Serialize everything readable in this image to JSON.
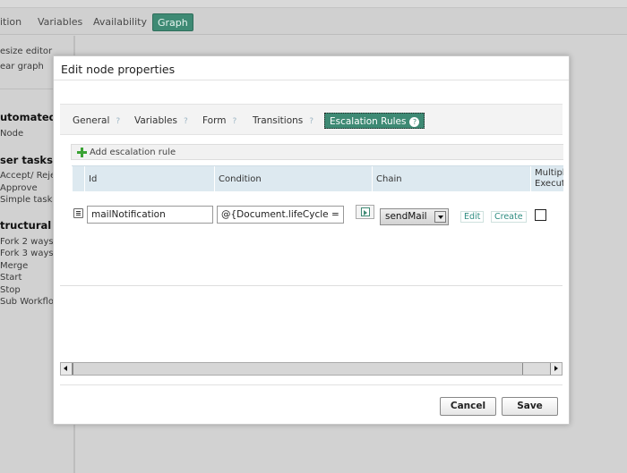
{
  "background": {
    "top_tabs": [
      {
        "label": "ition"
      },
      {
        "label": "Variables"
      },
      {
        "label": "Availability"
      },
      {
        "label": "Graph",
        "active": true
      }
    ],
    "left_panel": {
      "tools": [
        "esize editor",
        "ear graph"
      ],
      "sections": [
        {
          "title": "utomated t",
          "items": [
            "Node"
          ]
        },
        {
          "title": "ser tasks",
          "items": [
            "Accept/ Reject",
            "Approve",
            "Simple task"
          ]
        },
        {
          "title": "tructural n",
          "items": [
            "Fork 2 ways",
            "Fork 3 ways",
            "Merge",
            "Start",
            "Stop",
            "Sub Workflow"
          ]
        }
      ]
    }
  },
  "dialog": {
    "title": "Edit node properties",
    "tabs": [
      {
        "label": "General",
        "help": "?"
      },
      {
        "label": "Variables",
        "help": "?"
      },
      {
        "label": "Form",
        "help": "?"
      },
      {
        "label": "Transitions",
        "help": "?"
      },
      {
        "label": "Escalation Rules",
        "help": "?",
        "active": true
      }
    ],
    "add_rule_label": "Add escalation rule",
    "columns": [
      "Id",
      "Condition",
      "Chain",
      "Multipl Executi"
    ],
    "rows": [
      {
        "id": "mailNotification",
        "condition": "@{Document.lifeCycle ==",
        "chain": "sendMail",
        "edit_label": "Edit",
        "create_label": "Create",
        "multiple_execution": false
      }
    ],
    "cancel_label": "Cancel",
    "save_label": "Save"
  },
  "colors": {
    "accent": "#3e8a74",
    "header_bg": "#dde9f0",
    "link": "#2e8c80",
    "add_icon": "#3aa234"
  }
}
